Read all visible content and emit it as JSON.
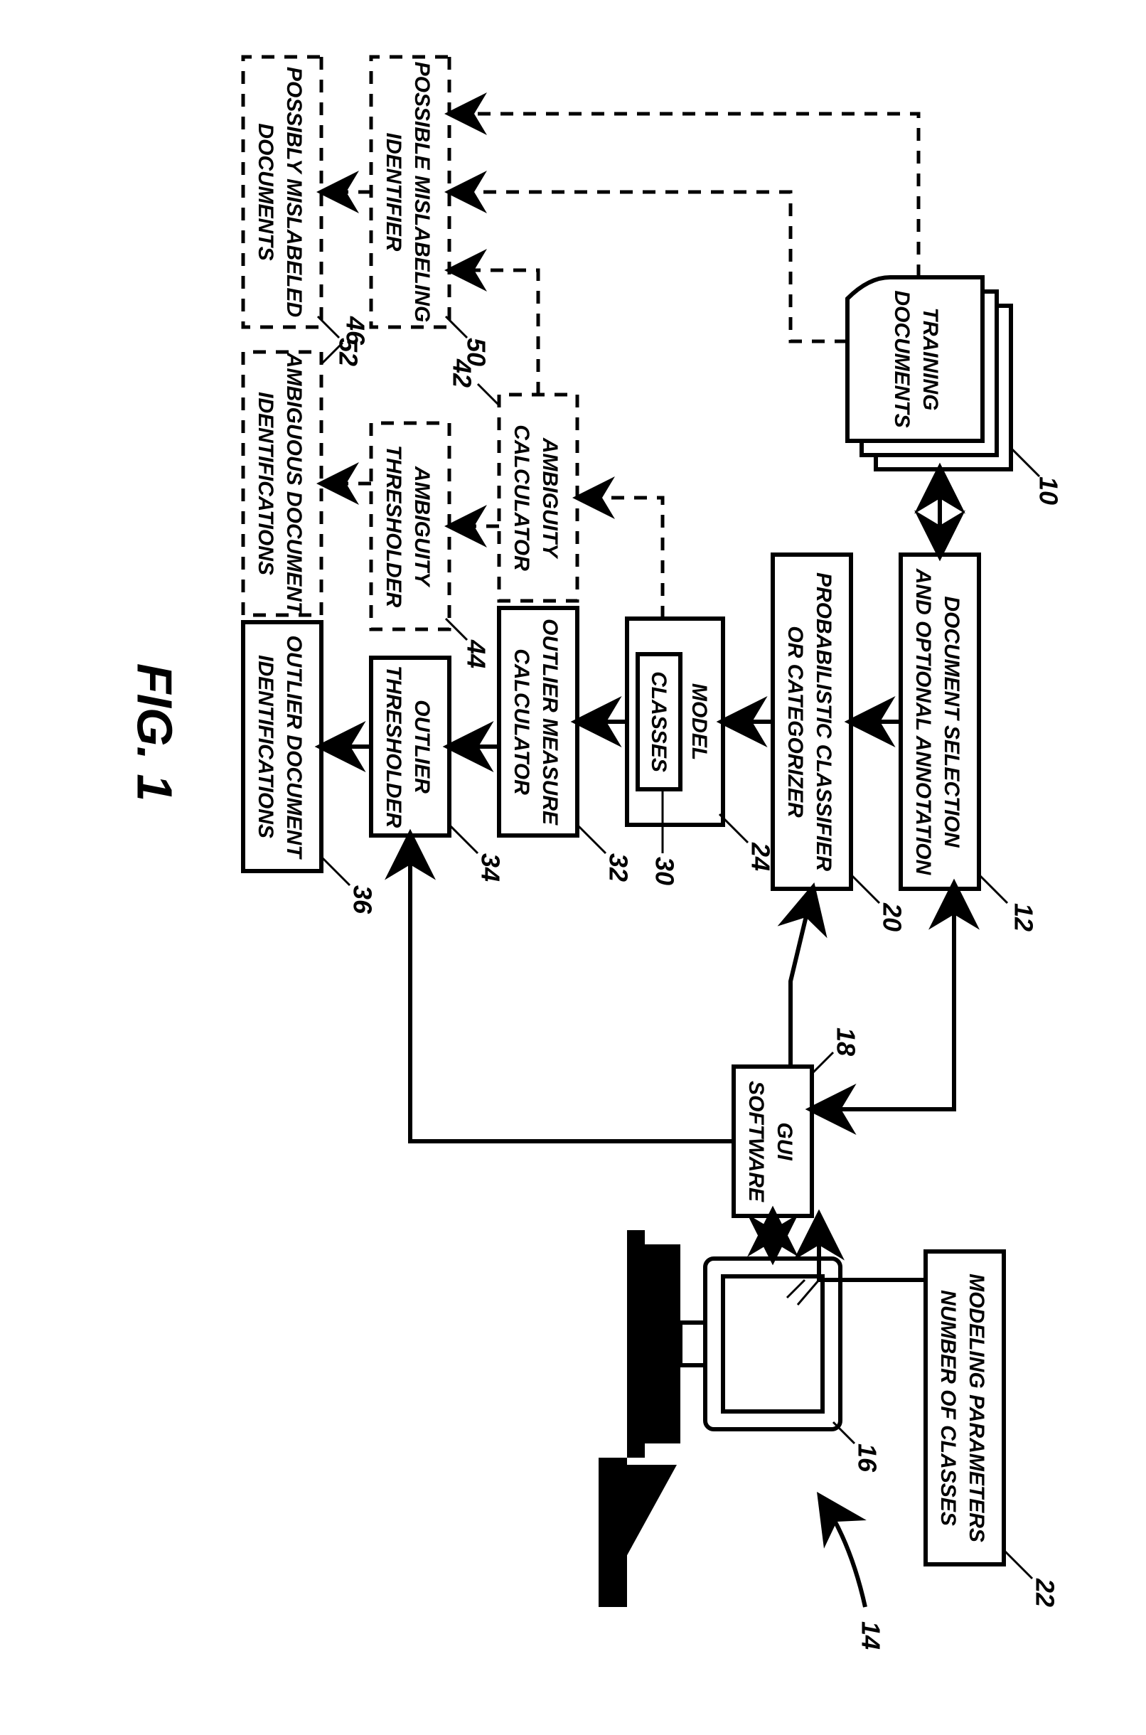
{
  "figure_label": "FIG. 1",
  "refs": {
    "training_docs": "10",
    "doc_selection": "12",
    "probabilistic_classifier": "20",
    "model": "24",
    "classes": "30",
    "outlier_measure_calc": "32",
    "outlier_threshold": "34",
    "outlier_ids": "36",
    "ambiguity_calc": "42",
    "ambiguity_threshold": "44",
    "ambiguous_ids": "46",
    "possible_mislabel_id": "50",
    "possibly_mislabeled": "52",
    "gui_software": "18",
    "modeling_params": "22",
    "computer": "14",
    "display": "16"
  },
  "blocks": {
    "training_docs": {
      "l1": "TRAINING",
      "l2": "DOCUMENTS"
    },
    "doc_selection": {
      "l1": "DOCUMENT SELECTION",
      "l2": "AND OPTIONAL ANNOTATION"
    },
    "probabilistic_classifier": {
      "l1": "PROBABILISTIC CLASSIFIER",
      "l2": "OR CATEGORIZER"
    },
    "model": {
      "l1": "MODEL"
    },
    "classes": {
      "l1": "CLASSES"
    },
    "outlier_measure_calc": {
      "l1": "OUTLIER MEASURE",
      "l2": "CALCULATOR"
    },
    "outlier_threshold": {
      "l1": "OUTLIER",
      "l2": "THRESHOLDER"
    },
    "outlier_ids": {
      "l1": "OUTLIER DOCUMENT",
      "l2": "IDENTIFICATIONS"
    },
    "ambiguity_calc": {
      "l1": "AMBIGUITY",
      "l2": "CALCULATOR"
    },
    "ambiguity_threshold": {
      "l1": "AMBIGUITY",
      "l2": "THRESHOLDER"
    },
    "ambiguous_ids": {
      "l1": "AMBIGUOUS DOCUMENT",
      "l2": "IDENTIFICATIONS"
    },
    "possible_mislabel_id": {
      "l1": "POSSIBLE MISLABELING",
      "l2": "IDENTIFIER"
    },
    "possibly_mislabeled": {
      "l1": "POSSIBLY MISLABELED",
      "l2": "DOCUMENTS"
    },
    "gui_software": {
      "l1": "GUI",
      "l2": "SOFTWARE"
    },
    "modeling_params": {
      "l1": "MODELING PARAMETERS",
      "l2": "NUMBER OF CLASSES"
    }
  }
}
